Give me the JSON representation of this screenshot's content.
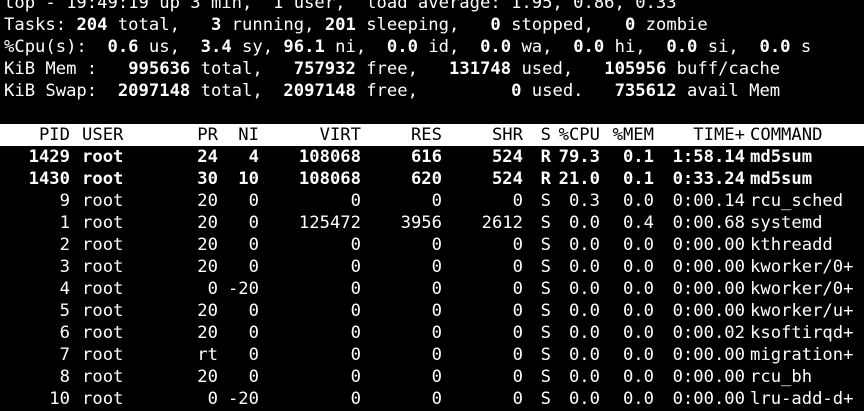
{
  "summary": {
    "line1": "top - 19:49:19 up 3 min,  1 user,  load average: 1.95, 0.86, 0.33",
    "tasks": {
      "label": "Tasks: ",
      "total": "204",
      "total_lbl": " total,   ",
      "running": "3",
      "running_lbl": " running, ",
      "sleeping": "201",
      "sleeping_lbl": " sleeping,   ",
      "stopped": "0",
      "stopped_lbl": " stopped,   ",
      "zombie": "0",
      "zombie_lbl": " zombie"
    },
    "cpu": {
      "label": "%Cpu(s):  ",
      "us": "0.6",
      "us_lbl": " us,  ",
      "sy": "3.4",
      "sy_lbl": " sy, ",
      "ni": "96.1",
      "ni_lbl": " ni,  ",
      "id": "0.0",
      "id_lbl": " id,  ",
      "wa": "0.0",
      "wa_lbl": " wa,  ",
      "hi": "0.0",
      "hi_lbl": " hi,  ",
      "si": "0.0",
      "si_lbl": " si,  ",
      "st": "0.0",
      "st_lbl": " s"
    },
    "mem": {
      "label": "KiB Mem :   ",
      "total": "995636",
      "total_lbl": " total,   ",
      "free": "757932",
      "free_lbl": " free,   ",
      "used": "131748",
      "used_lbl": " used,   ",
      "buff": "105956",
      "buff_lbl": " buff/cache"
    },
    "swap": {
      "label": "KiB Swap:  ",
      "total": "2097148",
      "total_lbl": " total,  ",
      "free": "2097148",
      "free_lbl": " free,         ",
      "used": "0",
      "used_lbl": " used.   ",
      "avail": "735612",
      "avail_lbl": " avail Mem"
    }
  },
  "columns": {
    "pid": "PID",
    "user": "USER",
    "pr": "PR",
    "ni": "NI",
    "virt": "VIRT",
    "res": "RES",
    "shr": "SHR",
    "s": "S",
    "cpu": "%CPU",
    "mem": "%MEM",
    "time": "TIME+",
    "command": "COMMAND"
  },
  "processes": [
    {
      "pid": "1429",
      "user": "root",
      "pr": "24",
      "ni": "4",
      "virt": "108068",
      "res": "616",
      "shr": "524",
      "s": "R",
      "cpu": "79.3",
      "mem": "0.1",
      "time": "1:58.14",
      "command": "md5sum",
      "bold": true
    },
    {
      "pid": "1430",
      "user": "root",
      "pr": "30",
      "ni": "10",
      "virt": "108068",
      "res": "620",
      "shr": "524",
      "s": "R",
      "cpu": "21.0",
      "mem": "0.1",
      "time": "0:33.24",
      "command": "md5sum",
      "bold": true
    },
    {
      "pid": "9",
      "user": "root",
      "pr": "20",
      "ni": "0",
      "virt": "0",
      "res": "0",
      "shr": "0",
      "s": "S",
      "cpu": "0.3",
      "mem": "0.0",
      "time": "0:00.14",
      "command": "rcu_sched",
      "bold": false
    },
    {
      "pid": "1",
      "user": "root",
      "pr": "20",
      "ni": "0",
      "virt": "125472",
      "res": "3956",
      "shr": "2612",
      "s": "S",
      "cpu": "0.0",
      "mem": "0.4",
      "time": "0:00.68",
      "command": "systemd",
      "bold": false
    },
    {
      "pid": "2",
      "user": "root",
      "pr": "20",
      "ni": "0",
      "virt": "0",
      "res": "0",
      "shr": "0",
      "s": "S",
      "cpu": "0.0",
      "mem": "0.0",
      "time": "0:00.00",
      "command": "kthreadd",
      "bold": false
    },
    {
      "pid": "3",
      "user": "root",
      "pr": "20",
      "ni": "0",
      "virt": "0",
      "res": "0",
      "shr": "0",
      "s": "S",
      "cpu": "0.0",
      "mem": "0.0",
      "time": "0:00.00",
      "command": "kworker/0+",
      "bold": false
    },
    {
      "pid": "4",
      "user": "root",
      "pr": "0",
      "ni": "-20",
      "virt": "0",
      "res": "0",
      "shr": "0",
      "s": "S",
      "cpu": "0.0",
      "mem": "0.0",
      "time": "0:00.00",
      "command": "kworker/0+",
      "bold": false
    },
    {
      "pid": "5",
      "user": "root",
      "pr": "20",
      "ni": "0",
      "virt": "0",
      "res": "0",
      "shr": "0",
      "s": "S",
      "cpu": "0.0",
      "mem": "0.0",
      "time": "0:00.00",
      "command": "kworker/u+",
      "bold": false
    },
    {
      "pid": "6",
      "user": "root",
      "pr": "20",
      "ni": "0",
      "virt": "0",
      "res": "0",
      "shr": "0",
      "s": "S",
      "cpu": "0.0",
      "mem": "0.0",
      "time": "0:00.02",
      "command": "ksoftirqd+",
      "bold": false
    },
    {
      "pid": "7",
      "user": "root",
      "pr": "rt",
      "ni": "0",
      "virt": "0",
      "res": "0",
      "shr": "0",
      "s": "S",
      "cpu": "0.0",
      "mem": "0.0",
      "time": "0:00.00",
      "command": "migration+",
      "bold": false
    },
    {
      "pid": "8",
      "user": "root",
      "pr": "20",
      "ni": "0",
      "virt": "0",
      "res": "0",
      "shr": "0",
      "s": "S",
      "cpu": "0.0",
      "mem": "0.0",
      "time": "0:00.00",
      "command": "rcu_bh",
      "bold": false
    },
    {
      "pid": "10",
      "user": "root",
      "pr": "0",
      "ni": "-20",
      "virt": "0",
      "res": "0",
      "shr": "0",
      "s": "S",
      "cpu": "0.0",
      "mem": "0.0",
      "time": "0:00.00",
      "command": "lru-add-d+",
      "bold": false
    }
  ]
}
